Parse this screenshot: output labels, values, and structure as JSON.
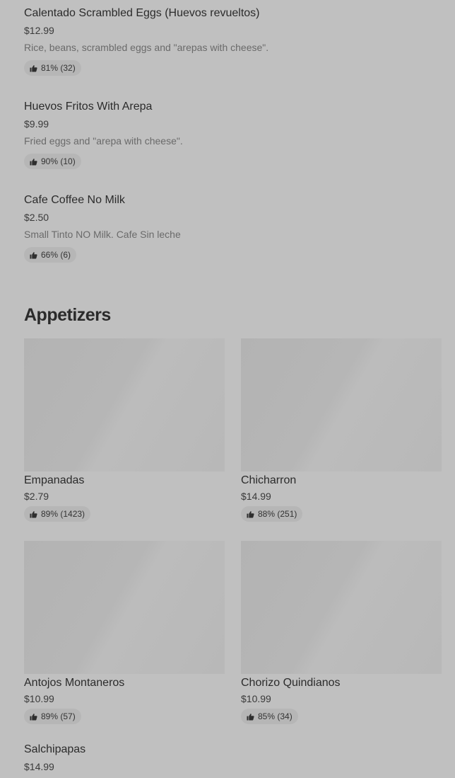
{
  "breakfast_items": [
    {
      "name": "Calentado Scrambled Eggs (Huevos revueltos)",
      "price": "$12.99",
      "description": "Rice, beans, scrambled eggs and \"arepas with cheese\".",
      "rating": "81% (32)"
    },
    {
      "name": "Huevos Fritos With Arepa",
      "price": "$9.99",
      "description": "Fried eggs and \"arepa with cheese\".",
      "rating": "90% (10)"
    },
    {
      "name": "Cafe Coffee No Milk",
      "price": "$2.50",
      "description": "Small Tinto NO Milk. Cafe Sin leche",
      "rating": "66% (6)"
    }
  ],
  "appetizers": {
    "title": "Appetizers",
    "items": [
      {
        "name": "Empanadas",
        "price": "$2.79",
        "rating": "89% (1423)"
      },
      {
        "name": "Chicharron",
        "price": "$14.99",
        "rating": "88% (251)"
      },
      {
        "name": "Antojos Montaneros",
        "price": "$10.99",
        "rating": "89% (57)"
      },
      {
        "name": "Chorizo Quindianos",
        "price": "$10.99",
        "rating": "85% (34)"
      },
      {
        "name": "Salchipapas",
        "price": "$14.99"
      }
    ]
  },
  "icons": {
    "rating": "thumbs-up-icon"
  }
}
